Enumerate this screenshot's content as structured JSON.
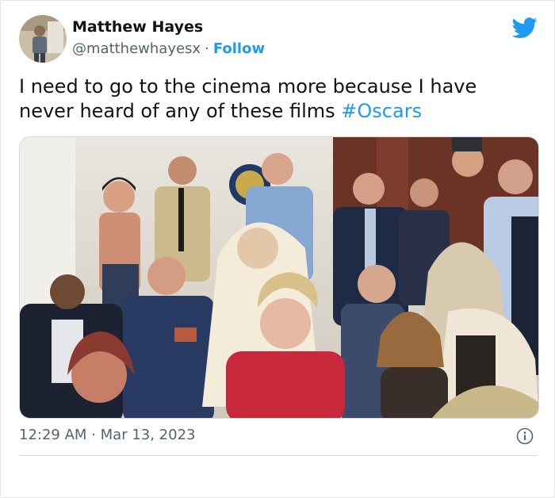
{
  "tweet": {
    "author_name": "Matthew Hayes",
    "author_handle": "@matthewhayesx",
    "separator": "·",
    "follow_label": "Follow",
    "text": "I need to go to the cinema more because I have never heard of any of these films ",
    "hashtag": "#Oscars",
    "time": "12:29 AM",
    "date_separator": "·",
    "date": "Mar 13, 2023"
  },
  "icons": {
    "brand": "twitter-bird-icon",
    "info": "info-icon"
  },
  "colors": {
    "accent": "#1d9bf0",
    "text_primary": "#0f1419",
    "text_secondary": "#536471",
    "border": "#cfd9de"
  }
}
